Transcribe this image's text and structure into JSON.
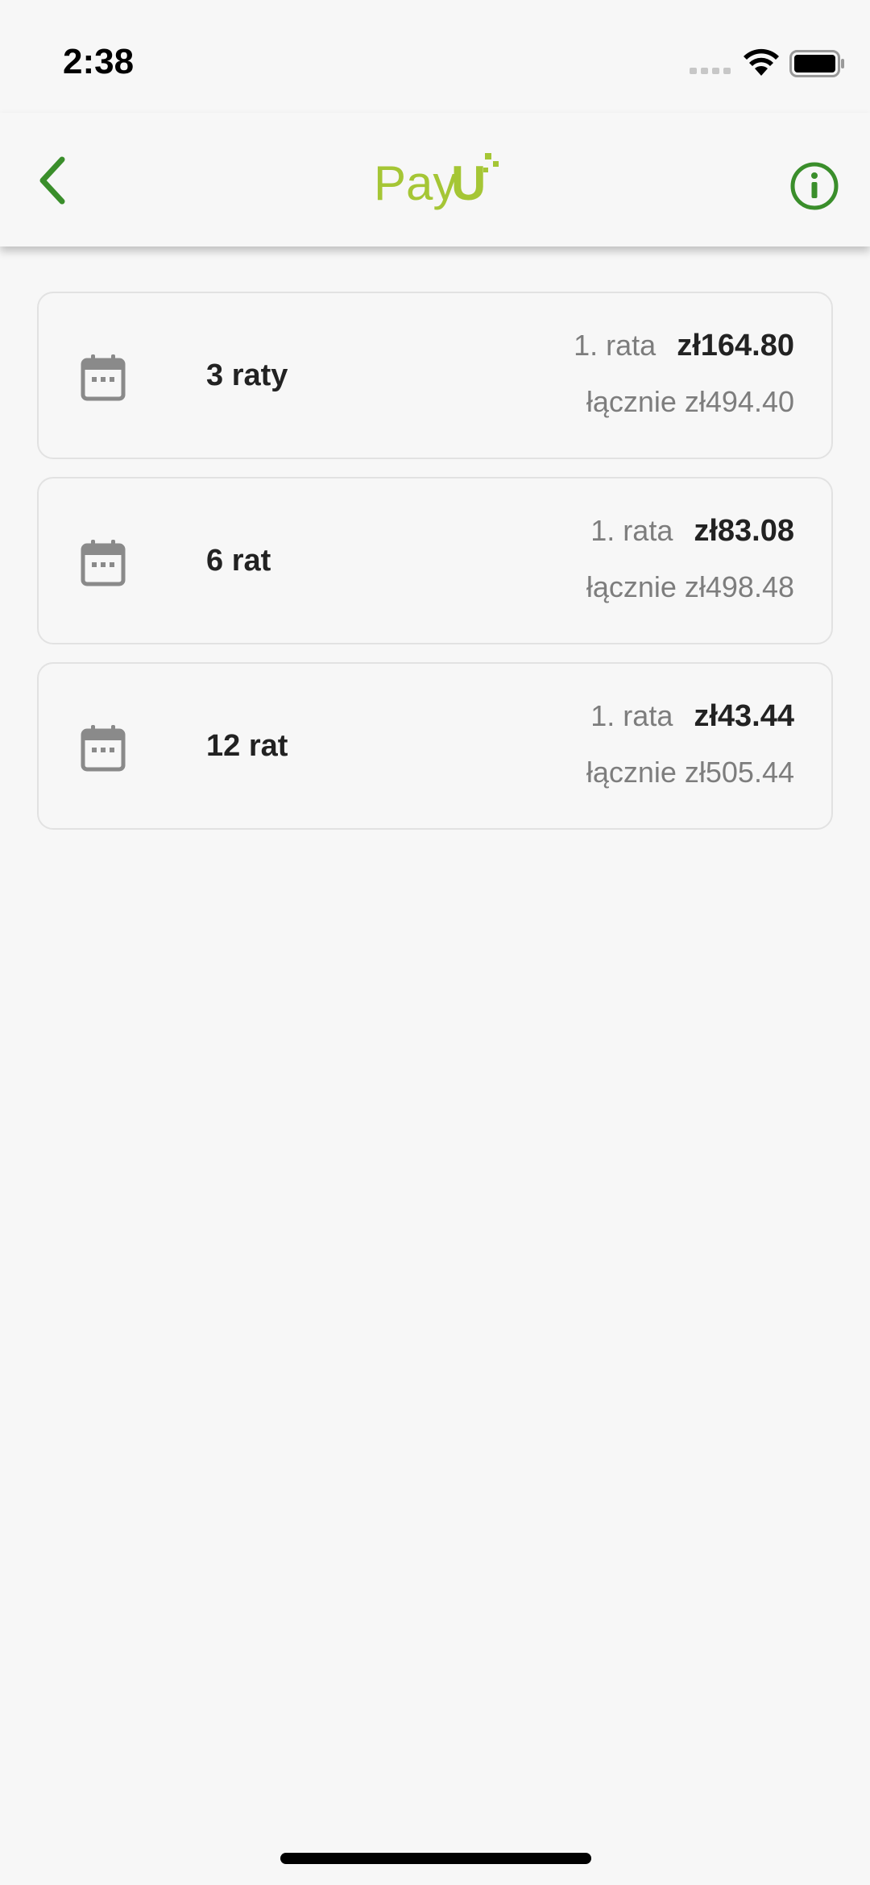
{
  "status_bar": {
    "time": "2:38"
  },
  "header": {
    "logo_text": "PayU",
    "back_icon": "chevron-left-icon",
    "info_icon": "info-circle-icon"
  },
  "colors": {
    "accent": "#3a8e2b",
    "logo_green": "#a5c635"
  },
  "plans": [
    {
      "name": "3 raty",
      "first_label": "1. rata",
      "first_amount": "zł164.80",
      "total": "łącznie zł494.40"
    },
    {
      "name": "6 rat",
      "first_label": "1. rata",
      "first_amount": "zł83.08",
      "total": "łącznie zł498.48"
    },
    {
      "name": "12 rat",
      "first_label": "1. rata",
      "first_amount": "zł43.44",
      "total": "łącznie zł505.44"
    }
  ]
}
